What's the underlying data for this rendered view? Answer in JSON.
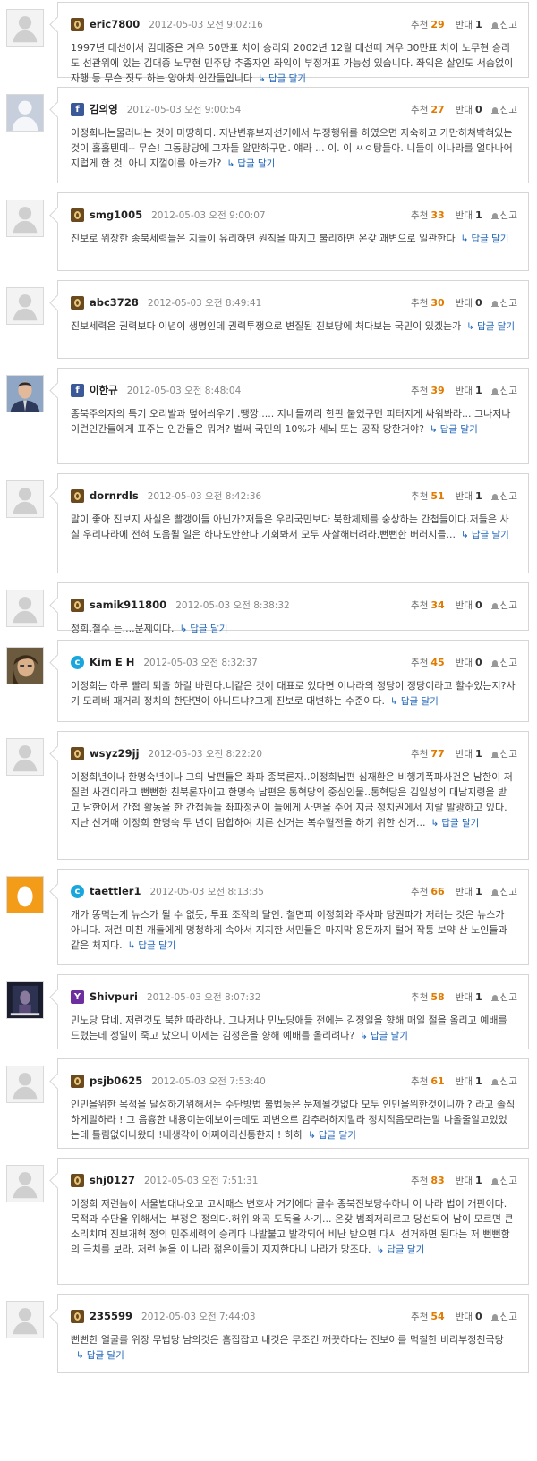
{
  "labels": {
    "recommend": "추천",
    "oppose": "반대",
    "report": "신고",
    "reply": "답글 달기"
  },
  "comments": [
    {
      "author": "eric7800",
      "service": "daum",
      "avatar": "default",
      "date": "2012-05-03 오전 9:02:16",
      "up": "29",
      "down": "1",
      "text": "1997년 대선에서 김대중은 겨우 50만표 차이 승리와 2002년 12월 대선때 겨우 30만표 차이 노무현 승리도 선관위에 있는 김대중 노무현 민주당 추종자인 좌익이 부정개표 가능성 있습니다. 좌익은 살인도 서슴없이 자행 등 무슨 짓도 하는 양아치 인간들입니다"
    },
    {
      "author": "김의영",
      "service": "facebook",
      "avatar": "silhouette",
      "date": "2012-05-03 오전 9:00:54",
      "up": "27",
      "down": "0",
      "text": "이정희니는물러나는 것이 마땅하다. 지난변휴보자선거에서 부정행위를 하였으면 자숙하고 가만히쳐박혀있는 것이 홀홀텐데-- 무슨! 그동탕당에 그자들 알만하구먼. 얘라 ... 이. 이 ㅆㅇ탕들아. 니들이 이나라를 얼마나어지럽게 한 것. 아니 지껄이를 아는가?"
    },
    {
      "author": "smg1005",
      "service": "daum",
      "avatar": "default",
      "date": "2012-05-03 오전 9:00:07",
      "up": "33",
      "down": "1",
      "text": "진보로 위장한 종북세력들은 지들이 유리하면 원칙을 따지고 불리하면 온갖 괘변으로 일관한다"
    },
    {
      "author": "abc3728",
      "service": "daum",
      "avatar": "default",
      "date": "2012-05-03 오전 8:49:41",
      "up": "30",
      "down": "0",
      "text": "진보세력은 권력보다 이념이 생명인데 권력투쟁으로 변질된 진보당에 처다보는 국민이 있겠는가"
    },
    {
      "author": "이한규",
      "service": "facebook",
      "avatar": "photo-man",
      "date": "2012-05-03 오전 8:48:04",
      "up": "39",
      "down": "1",
      "text": "종북주의자의 특기 오리발과 덮어씌우기 .땡깡..... 지네들끼리 한판 붙었구먼 피터지게 싸워봐라... 그나저나 이런인간들에게 표주는 인간들은 뭐겨? 벌써 국민의 10%가 세뇌 또는 공작 당한거야?"
    },
    {
      "author": "dornrdls",
      "service": "daum",
      "avatar": "default",
      "date": "2012-05-03 오전 8:42:36",
      "up": "51",
      "down": "1",
      "text": "말이 좋아 진보지 사실은 빨갱이들 아닌가?저들은 우리국민보다 북한체제를 숭상하는 간첩들이다.저들은 사실 우리나라에 전혀 도움될 일은 하나도안한다.기회봐서 모두 사살해버려라.뻔뻔한 버러지들..."
    },
    {
      "author": "samik911800",
      "service": "daum",
      "avatar": "default",
      "date": "2012-05-03 오전 8:38:32",
      "up": "34",
      "down": "0",
      "text": "정희.철수 는....문제이다."
    },
    {
      "author": "Kim E H",
      "service": "cyworld",
      "avatar": "photo-hair",
      "date": "2012-05-03 오전 8:32:37",
      "up": "45",
      "down": "0",
      "text": "이정희는 하루 빨리 퇴출 하길 바란다.너같은 것이 대표로 있다면 이나라의 정당이 정당이라고 할수있는지?사기 모리배 패거리 정치의 한단면이 아니드냐?그게 진보로 대변하는 수준이다."
    },
    {
      "author": "wsyz29jj",
      "service": "daum",
      "avatar": "default",
      "date": "2012-05-03 오전 8:22:20",
      "up": "77",
      "down": "1",
      "text": "이정희년이나 한명숙년이나 그의 남편들은 좌파 종북론자..이정희남편 심재환은 비행기폭파사건은 남한이 저질런 사건이라고 뻔뻔한 친북론자이고 한명숙 남편은 통혁당의 중심인물..통혁당은 김일성의 대남지령을 받고 남한에서 간첩 활동을 한 간첩놈들 좌파정권이 들에게 사면을 주어 지금 정치권에서 지랄 발광하고 있다. 지난 선거때 이정희 한명숙 두 년이 담합하여 치른 선거는 복수혈전을 하기 위한 선거..."
    },
    {
      "author": "taettler1",
      "service": "cyworld",
      "avatar": "egg",
      "date": "2012-05-03 오전 8:13:35",
      "up": "66",
      "down": "1",
      "text": "개가 똥먹는게 뉴스가 될 수 없듯, 투표 조작의 달인. 철면피 이정희와 주사파 당권파가 저러는 것은 뉴스가 아니다. 저런 미친 개들에게 멍청하게 속아서 지지한 서민들은 마지막 용돈까지 털어 작퉁 보약 산 노인들과 같은 처지다."
    },
    {
      "author": "Shivpuri",
      "service": "yahoo",
      "avatar": "photo-dark",
      "date": "2012-05-03 오전 8:07:32",
      "up": "58",
      "down": "1",
      "text": "민노당 답네. 저런것도 북한 따라하나. 그나저나 민노당애들 전에는 김정일을 향해 매일 절을 올리고 예배를 드렸는데 정일이 죽고 났으니 이제는 김정은을 향해 예배를 올리려나?"
    },
    {
      "author": "psjb0625",
      "service": "daum",
      "avatar": "default",
      "date": "2012-05-03 오전 7:53:40",
      "up": "61",
      "down": "1",
      "text": "인민을위한 목적을 달성하기위해서는 수단방법 불법등은 문제될것없다 모두 인민을위한것이니까 ? 라고 솔직하게말하라 ! 그 음흉한 내용이눈에보이는데도 괴변으로 감추려하지말라 정치적음모라는말 나올줄알고있었는데 틀림없이나왔다 !내생각이 어찌이리신통한지 ! 하하"
    },
    {
      "author": "shj0127",
      "service": "daum",
      "avatar": "default",
      "date": "2012-05-03 오전 7:51:31",
      "up": "83",
      "down": "1",
      "text": "이정희 저런놈이 서울법대나오고 고시패스 변호사 거기에다 골수 종북진보당수하니 이 나라 법이 개판이다. 목적과 수단을 위해서는 부정은 정의다.허위 왜곡 도둑을 사기... 온갖 범죄저리르고 당선되어 남이 모르면 큰소리치며 진보개혁 정의 민주세력의 승리다 나발불고 발각되어 비난 받으면 다시 선거하면 된다는 저 뻔뻔함의 극치를 보라. 저런 놈을 이 나라 젊은이들이 지지한다니 나라가 망조다."
    },
    {
      "author": "235599",
      "service": "daum",
      "avatar": "default",
      "date": "2012-05-03 오전 7:44:03",
      "up": "54",
      "down": "0",
      "text": "뻔뻔한 얼굴를 위장 무법당 남의것은 흠집잡고 내것은 무조건 깨끗하다는 진보이를 먹칠한 비리부정천국당"
    }
  ]
}
